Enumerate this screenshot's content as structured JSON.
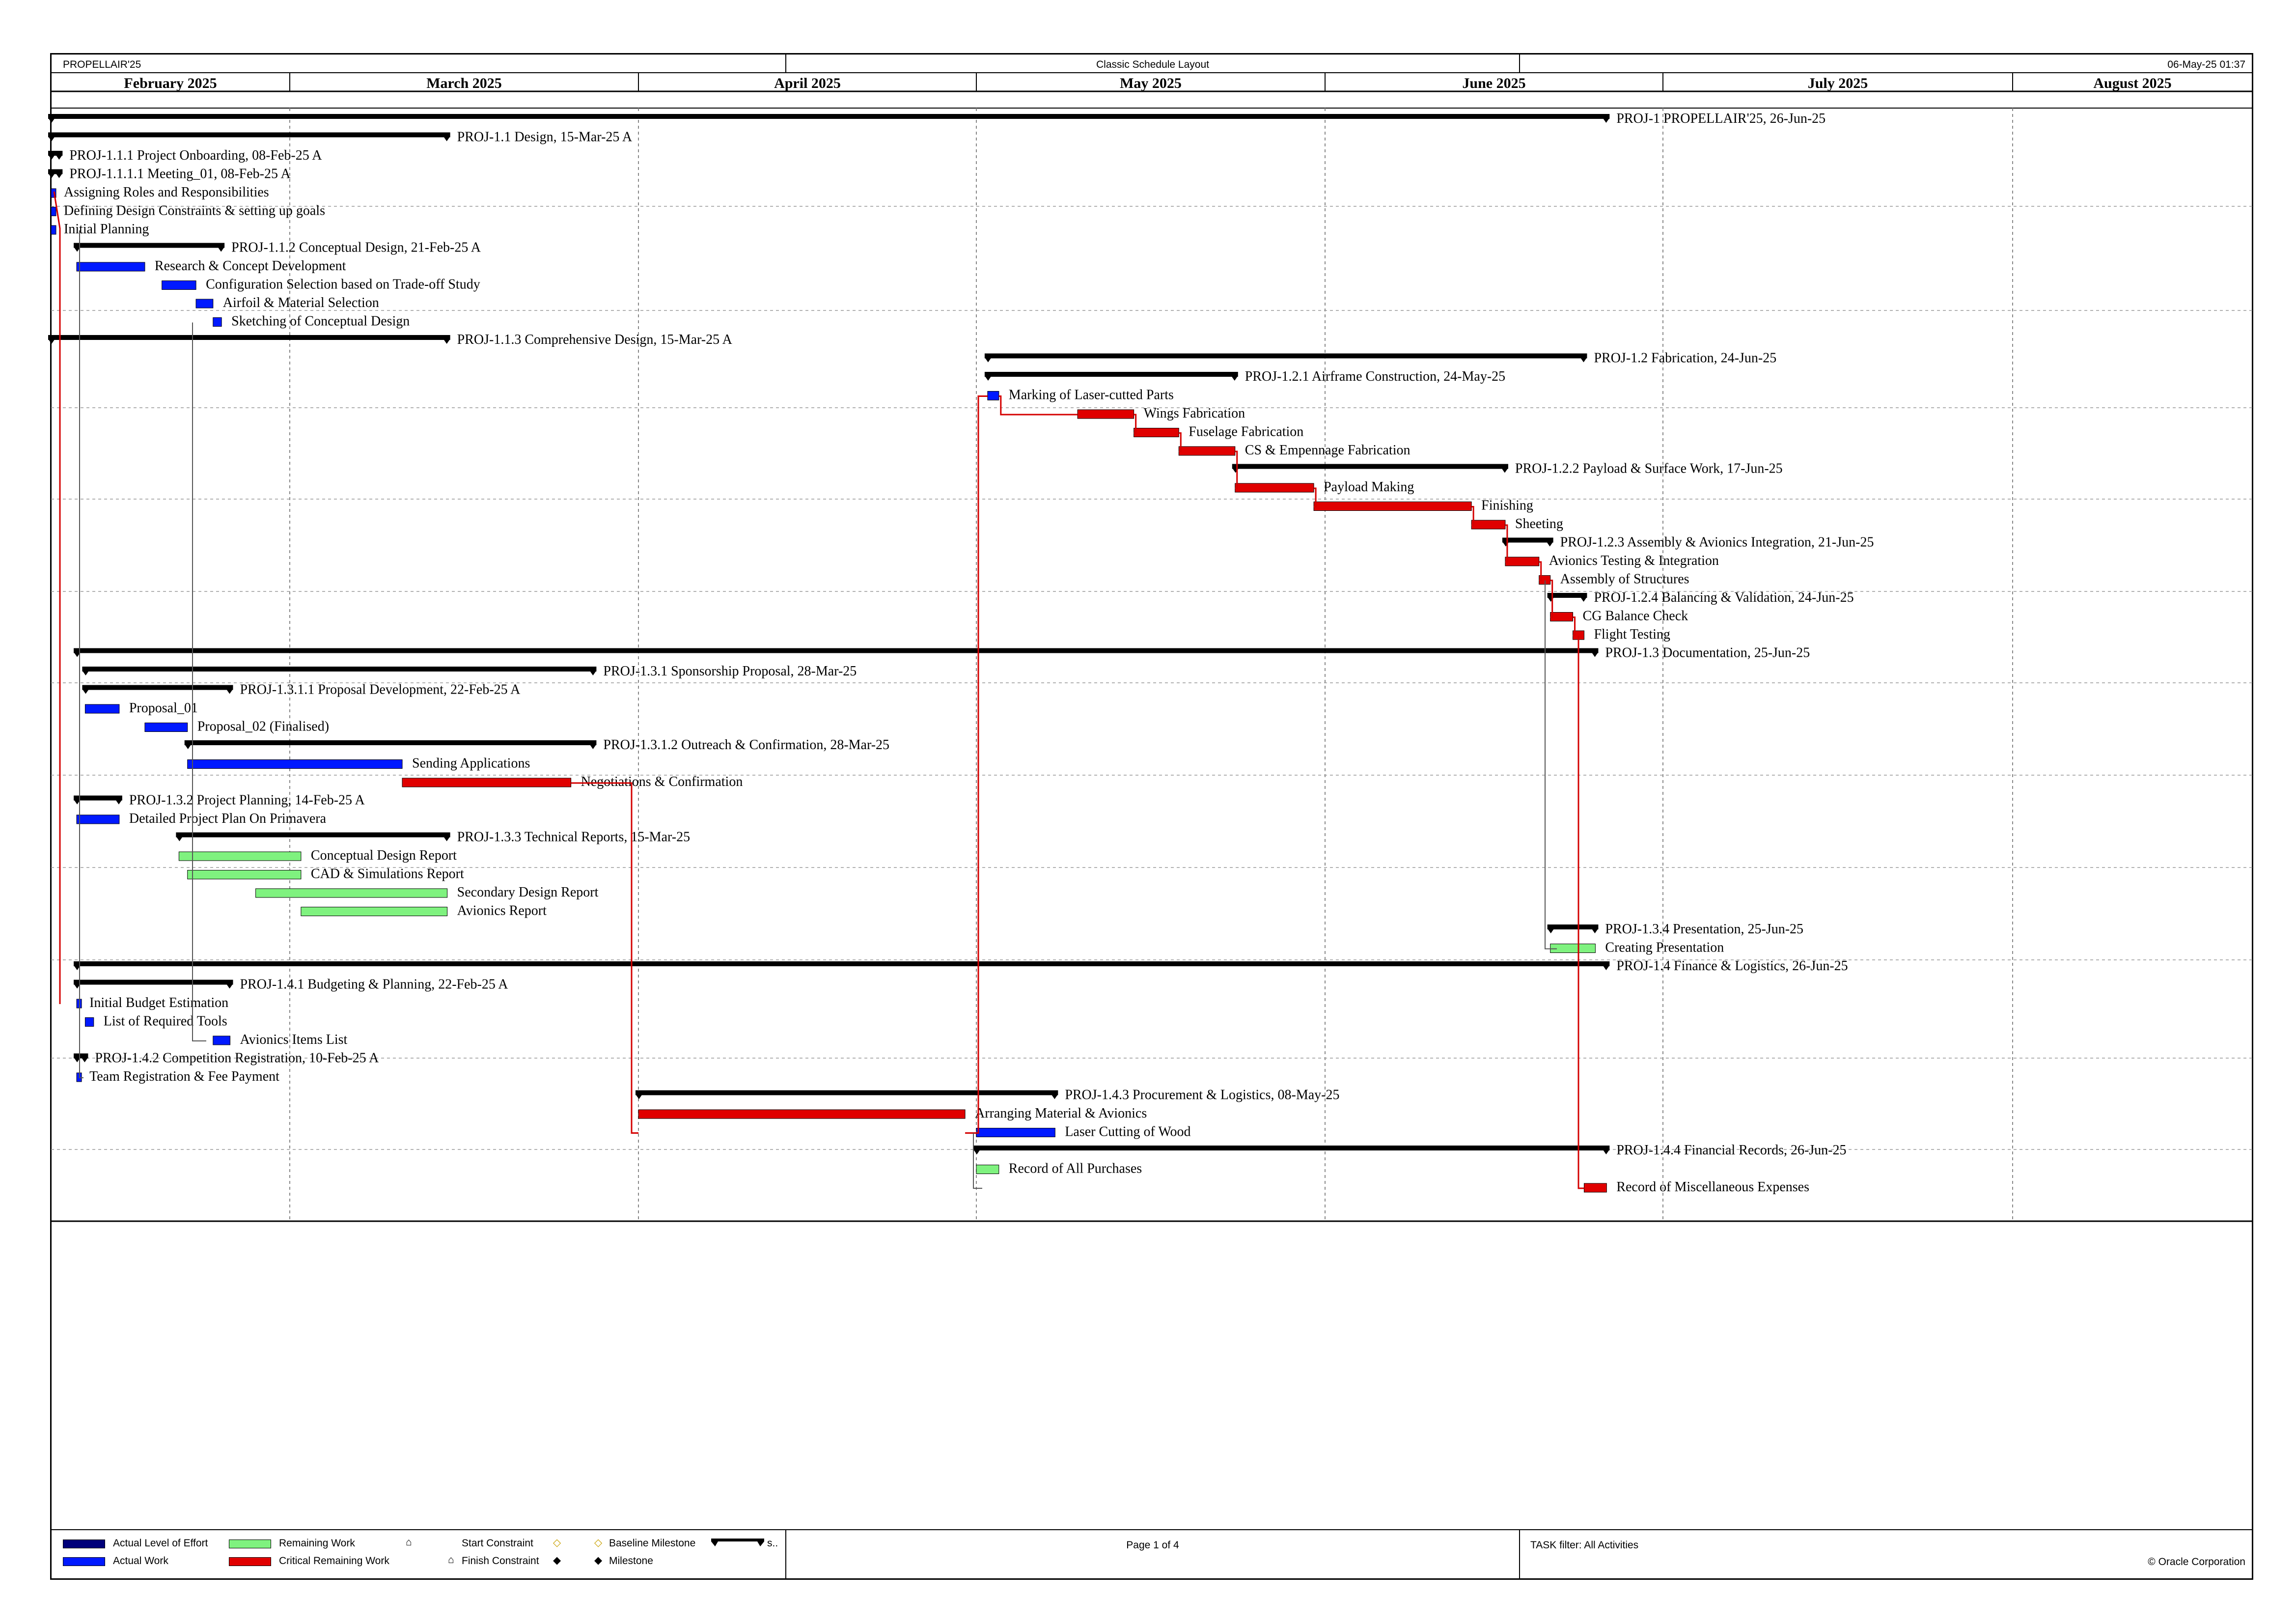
{
  "header": {
    "project": "PROPELLAIR'25",
    "layout": "Classic Schedule Layout",
    "date": "06-May-25 01:37"
  },
  "footer": {
    "page": "Page 1 of 4",
    "filter": "TASK filter: All Activities",
    "copyright": "© Oracle Corporation",
    "legend": {
      "actual_loe": "Actual Level of Effort",
      "actual_work": "Actual Work",
      "remaining": "Remaining Work",
      "critical": "Critical Remaining Work",
      "start_constraint": "Start Constraint",
      "finish_constraint": "Finish Constraint",
      "baseline_milestone": "Baseline Milestone",
      "milestone": "Milestone",
      "summary": "s.."
    }
  },
  "colors": {
    "summary": "#000000",
    "actual": "#0019ff",
    "critical": "#e00000",
    "remaining": "#7ff27f",
    "loe": "#00007a",
    "link_red": "#d40000"
  },
  "chart_data": {
    "type": "gantt",
    "months": [
      "February 2025",
      "March 2025",
      "April 2025",
      "May 2025",
      "June 2025",
      "July 2025",
      "August 2025"
    ],
    "activities": [
      {
        "label": "PROJ-1  PROPELLAIR'25, 26-Jun-25",
        "kind": "summary",
        "start": "2025-02-01",
        "end": "2025-06-26"
      },
      {
        "label": "PROJ-1.1  Design, 15-Mar-25 A",
        "kind": "summary",
        "start": "2025-02-01",
        "end": "2025-03-15"
      },
      {
        "label": "PROJ-1.1.1  Project Onboarding, 08-Feb-25 A",
        "kind": "summary",
        "start": "2025-02-01",
        "end": "2025-02-02"
      },
      {
        "label": "PROJ-1.1.1.1  Meeting_01, 08-Feb-25 A",
        "kind": "summary",
        "start": "2025-02-01",
        "end": "2025-02-02"
      },
      {
        "label": "Assigning Roles and Responsibilities",
        "kind": "actual",
        "start": "2025-02-01",
        "end": "2025-02-01"
      },
      {
        "label": "Defining Design Constraints & setting up goals",
        "kind": "actual",
        "start": "2025-02-01",
        "end": "2025-02-01"
      },
      {
        "label": "Initial Planning",
        "kind": "actual",
        "start": "2025-02-01",
        "end": "2025-02-01"
      },
      {
        "label": "PROJ-1.1.2  Conceptual Design, 21-Feb-25 A",
        "kind": "summary",
        "start": "2025-02-04",
        "end": "2025-02-21"
      },
      {
        "label": "Research & Concept Development",
        "kind": "actual",
        "start": "2025-02-04",
        "end": "2025-02-12"
      },
      {
        "label": "Configuration Selection based on Trade-off Study",
        "kind": "actual",
        "start": "2025-02-14",
        "end": "2025-02-18"
      },
      {
        "label": "Airfoil & Material Selection",
        "kind": "actual",
        "start": "2025-02-18",
        "end": "2025-02-20"
      },
      {
        "label": "Sketching of Conceptual Design",
        "kind": "actual",
        "start": "2025-02-20",
        "end": "2025-02-21"
      },
      {
        "label": "PROJ-1.1.3  Comprehensive Design, 15-Mar-25 A",
        "kind": "summary",
        "start": "2025-02-01",
        "end": "2025-03-15"
      },
      {
        "label": "PROJ-1.2  Fabrication, 24-Jun-25",
        "kind": "summary",
        "start": "2025-05-02",
        "end": "2025-06-24"
      },
      {
        "label": "PROJ-1.2.1  Airframe Construction, 24-May-25",
        "kind": "summary",
        "start": "2025-05-02",
        "end": "2025-05-24"
      },
      {
        "label": "Marking of Laser-cutted Parts",
        "kind": "actual",
        "start": "2025-05-02",
        "end": "2025-05-03"
      },
      {
        "label": "Wings Fabrication",
        "kind": "critical",
        "start": "2025-05-10",
        "end": "2025-05-15"
      },
      {
        "label": "Fuselage Fabrication",
        "kind": "critical",
        "start": "2025-05-15",
        "end": "2025-05-19"
      },
      {
        "label": "CS & Empennage Fabrication",
        "kind": "critical",
        "start": "2025-05-19",
        "end": "2025-05-24"
      },
      {
        "label": "PROJ-1.2.2  Payload & Surface Work, 17-Jun-25",
        "kind": "summary",
        "start": "2025-05-24",
        "end": "2025-06-17"
      },
      {
        "label": "Payload Making",
        "kind": "critical",
        "start": "2025-05-24",
        "end": "2025-05-31"
      },
      {
        "label": "Finishing",
        "kind": "critical",
        "start": "2025-05-31",
        "end": "2025-06-14"
      },
      {
        "label": "Sheeting",
        "kind": "critical",
        "start": "2025-06-14",
        "end": "2025-06-17"
      },
      {
        "label": "PROJ-1.2.3  Assembly & Avionics Integration, 21-Jun-25",
        "kind": "summary",
        "start": "2025-06-17",
        "end": "2025-06-21"
      },
      {
        "label": "Avionics Testing & Integration",
        "kind": "critical",
        "start": "2025-06-17",
        "end": "2025-06-20"
      },
      {
        "label": "Assembly of Structures",
        "kind": "critical",
        "start": "2025-06-20",
        "end": "2025-06-21"
      },
      {
        "label": "PROJ-1.2.4  Balancing & Validation, 24-Jun-25",
        "kind": "summary",
        "start": "2025-06-21",
        "end": "2025-06-24"
      },
      {
        "label": "CG Balance Check",
        "kind": "critical",
        "start": "2025-06-21",
        "end": "2025-06-23"
      },
      {
        "label": "Flight Testing",
        "kind": "critical",
        "start": "2025-06-23",
        "end": "2025-06-24"
      },
      {
        "label": "PROJ-1.3  Documentation, 25-Jun-25",
        "kind": "summary",
        "start": "2025-02-04",
        "end": "2025-06-25"
      },
      {
        "label": "PROJ-1.3.1  Sponsorship Proposal, 28-Mar-25",
        "kind": "summary",
        "start": "2025-02-05",
        "end": "2025-03-28"
      },
      {
        "label": "PROJ-1.3.1.1  Proposal Development, 22-Feb-25 A",
        "kind": "summary",
        "start": "2025-02-05",
        "end": "2025-02-22"
      },
      {
        "label": "Proposal_01",
        "kind": "actual",
        "start": "2025-02-05",
        "end": "2025-02-09"
      },
      {
        "label": "Proposal_02 (Finalised)",
        "kind": "actual",
        "start": "2025-02-12",
        "end": "2025-02-17"
      },
      {
        "label": "PROJ-1.3.1.2  Outreach & Confirmation, 28-Mar-25",
        "kind": "summary",
        "start": "2025-02-17",
        "end": "2025-03-28"
      },
      {
        "label": "Sending Applications",
        "kind": "actual",
        "start": "2025-02-17",
        "end": "2025-03-11"
      },
      {
        "label": "Negotiations & Confirmation",
        "kind": "critical",
        "start": "2025-03-11",
        "end": "2025-03-26"
      },
      {
        "label": "PROJ-1.3.2  Project Planning, 14-Feb-25 A",
        "kind": "summary",
        "start": "2025-02-04",
        "end": "2025-02-09"
      },
      {
        "label": "Detailed Project Plan On Primavera",
        "kind": "actual",
        "start": "2025-02-04",
        "end": "2025-02-09"
      },
      {
        "label": "PROJ-1.3.3  Technical Reports, 15-Mar-25",
        "kind": "summary",
        "start": "2025-02-16",
        "end": "2025-03-15"
      },
      {
        "label": "Conceptual Design Report",
        "kind": "remaining",
        "start": "2025-02-16",
        "end": "2025-03-02"
      },
      {
        "label": "CAD & Simulations Report",
        "kind": "remaining",
        "start": "2025-02-17",
        "end": "2025-03-02"
      },
      {
        "label": "Secondary Design Report",
        "kind": "remaining",
        "start": "2025-02-25",
        "end": "2025-03-15"
      },
      {
        "label": "Avionics Report",
        "kind": "remaining",
        "start": "2025-03-02",
        "end": "2025-03-15"
      },
      {
        "label": "PROJ-1.3.4  Presentation, 25-Jun-25",
        "kind": "summary",
        "start": "2025-06-21",
        "end": "2025-06-25"
      },
      {
        "label": "Creating Presentation",
        "kind": "remaining",
        "start": "2025-06-21",
        "end": "2025-06-25"
      },
      {
        "label": "PROJ-1.4  Finance & Logistics, 26-Jun-25",
        "kind": "summary",
        "start": "2025-02-04",
        "end": "2025-06-26"
      },
      {
        "label": "PROJ-1.4.1  Budgeting & Planning, 22-Feb-25 A",
        "kind": "summary",
        "start": "2025-02-04",
        "end": "2025-02-22"
      },
      {
        "label": "Initial Budget Estimation",
        "kind": "actual",
        "start": "2025-02-04",
        "end": "2025-02-04"
      },
      {
        "label": "List of Required Tools",
        "kind": "actual",
        "start": "2025-02-05",
        "end": "2025-02-06"
      },
      {
        "label": "Avionics Items List",
        "kind": "actual",
        "start": "2025-02-20",
        "end": "2025-02-22"
      },
      {
        "label": "PROJ-1.4.2  Competition Registration, 10-Feb-25 A",
        "kind": "summary",
        "start": "2025-02-04",
        "end": "2025-02-05"
      },
      {
        "label": "Team Registration & Fee Payment",
        "kind": "actual",
        "start": "2025-02-04",
        "end": "2025-02-04"
      },
      {
        "label": "PROJ-1.4.3  Procurement & Logistics, 08-May-25",
        "kind": "summary",
        "start": "2025-04-01",
        "end": "2025-05-08"
      },
      {
        "label": "Arranging Material & Avionics",
        "kind": "critical",
        "start": "2025-04-01",
        "end": "2025-04-30"
      },
      {
        "label": "Laser Cutting of Wood",
        "kind": "actual",
        "start": "2025-05-01",
        "end": "2025-05-08"
      },
      {
        "label": "PROJ-1.4.4  Financial Records, 26-Jun-25",
        "kind": "summary",
        "start": "2025-05-01",
        "end": "2025-06-26"
      },
      {
        "label": "Record of All Purchases",
        "kind": "remaining",
        "start": "2025-05-01",
        "end": "2025-05-03"
      },
      {
        "label": "Record of Miscellaneous Expenses",
        "kind": "critical",
        "start": "2025-06-24",
        "end": "2025-06-26"
      }
    ]
  }
}
